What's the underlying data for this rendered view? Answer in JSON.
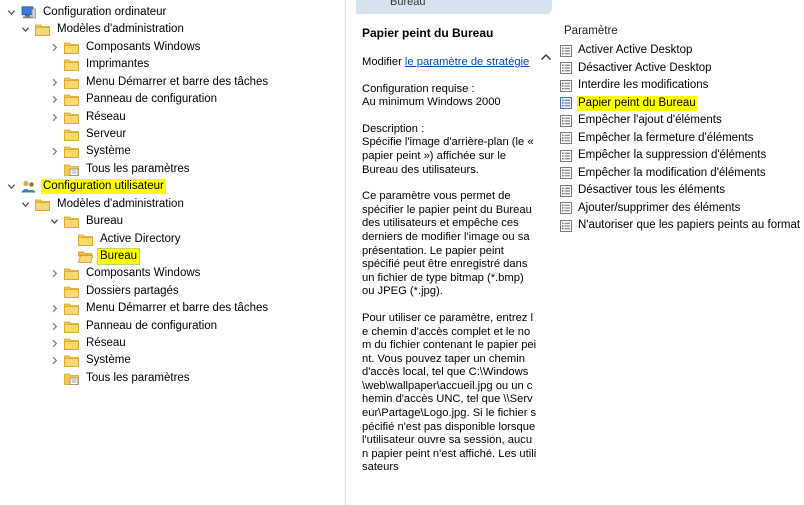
{
  "tree": {
    "items": [
      {
        "label": "Configuration ordinateur",
        "level": 0,
        "expander": "expanded",
        "icon": "computer-icon",
        "highlight": "none"
      },
      {
        "label": "Modèles d'administration",
        "level": 1,
        "expander": "expanded",
        "icon": "folder-icon",
        "highlight": "none"
      },
      {
        "label": "Composants Windows",
        "level": 2,
        "expander": "collapsed",
        "icon": "folder-icon",
        "highlight": "none"
      },
      {
        "label": "Imprimantes",
        "level": 2,
        "expander": "none",
        "icon": "folder-icon",
        "highlight": "none"
      },
      {
        "label": "Menu Démarrer et barre des tâches",
        "level": 2,
        "expander": "collapsed",
        "icon": "folder-icon",
        "highlight": "none"
      },
      {
        "label": "Panneau de configuration",
        "level": 2,
        "expander": "collapsed",
        "icon": "folder-icon",
        "highlight": "none"
      },
      {
        "label": "Réseau",
        "level": 2,
        "expander": "collapsed",
        "icon": "folder-icon",
        "highlight": "none"
      },
      {
        "label": "Serveur",
        "level": 2,
        "expander": "none",
        "icon": "folder-icon",
        "highlight": "none"
      },
      {
        "label": "Système",
        "level": 2,
        "expander": "collapsed",
        "icon": "folder-icon",
        "highlight": "none"
      },
      {
        "label": "Tous les paramètres",
        "level": 2,
        "expander": "none",
        "icon": "settings-folder-icon",
        "highlight": "none"
      },
      {
        "label": "Configuration utilisateur",
        "level": 0,
        "expander": "expanded",
        "icon": "user-icon",
        "highlight": "yellow"
      },
      {
        "label": "Modèles d'administration",
        "level": 1,
        "expander": "expanded",
        "icon": "folder-icon",
        "highlight": "none"
      },
      {
        "label": "Bureau",
        "level": 2,
        "expander": "expanded",
        "icon": "folder-icon",
        "highlight": "none"
      },
      {
        "label": "Active Directory",
        "level": 3,
        "expander": "none",
        "icon": "folder-icon",
        "highlight": "none"
      },
      {
        "label": "Bureau",
        "level": 3,
        "expander": "none",
        "icon": "folder-open-icon",
        "highlight": "selected"
      },
      {
        "label": "Composants Windows",
        "level": 2,
        "expander": "collapsed",
        "icon": "folder-icon",
        "highlight": "none"
      },
      {
        "label": "Dossiers partagés",
        "level": 2,
        "expander": "none",
        "icon": "folder-icon",
        "highlight": "none"
      },
      {
        "label": "Menu Démarrer et barre des tâches",
        "level": 2,
        "expander": "collapsed",
        "icon": "folder-icon",
        "highlight": "none"
      },
      {
        "label": "Panneau de configuration",
        "level": 2,
        "expander": "collapsed",
        "icon": "folder-icon",
        "highlight": "none"
      },
      {
        "label": "Réseau",
        "level": 2,
        "expander": "collapsed",
        "icon": "folder-icon",
        "highlight": "none"
      },
      {
        "label": "Système",
        "level": 2,
        "expander": "collapsed",
        "icon": "folder-icon",
        "highlight": "none"
      },
      {
        "label": "Tous les paramètres",
        "level": 2,
        "expander": "none",
        "icon": "settings-folder-icon",
        "highlight": "none"
      }
    ]
  },
  "description": {
    "header_tab": "Bureau",
    "title": "Papier peint du Bureau",
    "modify_prefix": "Modifier ",
    "modify_link": "le paramètre de stratégie",
    "requirements": [
      "Configuration requise :",
      "Au minimum Windows 2000"
    ],
    "description_label": "Description :",
    "description_text": "Spécifie l'image d'arrière-plan (le « papier peint ») affichée sur le Bureau des utilisateurs.",
    "paragraph_2": "Ce paramètre vous permet de spécifier le papier peint du Bureau des utilisateurs et empêche ces derniers de modifier l'image ou sa présentation. Le papier peint spécifié peut être enregistré dans un fichier de type bitmap (*.bmp) ou JPEG (*.jpg).",
    "paragraph_3": "Pour utiliser ce paramètre, entrez le chemin d'accès complet et le nom du fichier contenant le papier peint. Vous pouvez taper un chemin d'accès local, tel que C:\\Windows\\web\\wallpaper\\accueil.jpg ou un chemin d'accès UNC, tel que \\\\Serveur\\Partage\\Logo.jpg. Si le fichier spécifié n'est pas disponible lorsque l'utilisateur ouvre sa session, aucun papier peint n'est affiché. Les utilisateurs"
  },
  "settings": {
    "column_header": "Paramètre",
    "items": [
      {
        "label": "Activer Active Desktop",
        "selected": false
      },
      {
        "label": "Désactiver Active Desktop",
        "selected": false
      },
      {
        "label": "Interdire les modifications",
        "selected": false
      },
      {
        "label": "Papier peint du Bureau",
        "selected": true
      },
      {
        "label": "Empêcher l'ajout d'éléments",
        "selected": false
      },
      {
        "label": "Empêcher la fermeture d'éléments",
        "selected": false
      },
      {
        "label": "Empêcher la suppression d'éléments",
        "selected": false
      },
      {
        "label": "Empêcher la modification d'éléments",
        "selected": false
      },
      {
        "label": "Désactiver tous les éléments",
        "selected": false
      },
      {
        "label": "Ajouter/supprimer des éléments",
        "selected": false
      },
      {
        "label": "N'autoriser que les papiers peints au format bitmap",
        "selected": false
      }
    ]
  },
  "colors": {
    "highlight": "#ffff00",
    "link": "#0645ad",
    "folder": "#f3c94b",
    "header_tab": "#d5e3f1"
  }
}
